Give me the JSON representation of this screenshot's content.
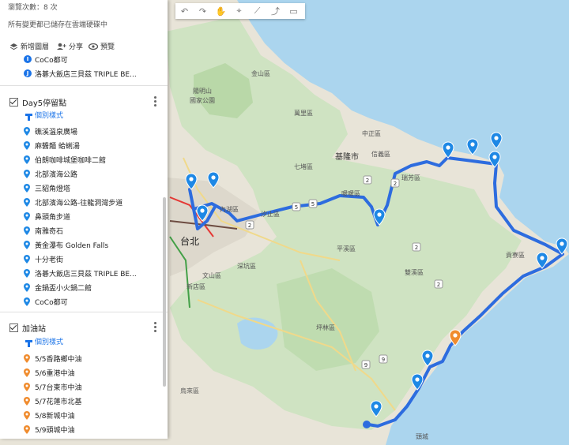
{
  "panel": {
    "views_line": "瀏覽次數：8 次",
    "saved_line": "所有變更都已儲存在雲端硬碟中",
    "actions": {
      "add_layer": "新增圖層",
      "share": "分享",
      "preview": "預覽"
    },
    "top_list": [
      {
        "badge": "I",
        "label": "CoCo都可"
      },
      {
        "badge": "J",
        "label": "洛碁大飯店三貝茲 TRIPLE BE..."
      }
    ],
    "layers": [
      {
        "title": "Day5停留點",
        "style_link": "個別樣式",
        "items": [
          {
            "label": "礁溪溫泉廣場",
            "color": "#1e88e5"
          },
          {
            "label": "麻醬麵 蛤蜊湯",
            "color": "#1e88e5"
          },
          {
            "label": "伯朗咖啡城堡咖啡二館",
            "color": "#1e88e5"
          },
          {
            "label": "北部濱海公路",
            "color": "#1e88e5"
          },
          {
            "label": "三貂角燈塔",
            "color": "#1e88e5"
          },
          {
            "label": "北部濱海公路-往龍洞灣步道",
            "color": "#1e88e5"
          },
          {
            "label": "鼻頭角步道",
            "color": "#1e88e5"
          },
          {
            "label": "南雅奇石",
            "color": "#1e88e5"
          },
          {
            "label": "黃金瀑布 Golden Falls",
            "color": "#1e88e5"
          },
          {
            "label": "十分老街",
            "color": "#1e88e5"
          },
          {
            "label": "洛碁大飯店三貝茲 TRIPLE BE...",
            "color": "#1e88e5"
          },
          {
            "label": "金鍋盃小火鍋二館",
            "color": "#1e88e5"
          },
          {
            "label": "CoCo都可",
            "color": "#1e88e5"
          }
        ]
      },
      {
        "title": "加油站",
        "style_link": "個別樣式",
        "items": [
          {
            "label": "5/5香路鄉中油",
            "color": "#f08c2e"
          },
          {
            "label": "5/6重港中油",
            "color": "#f08c2e"
          },
          {
            "label": "5/7台東市中油",
            "color": "#f08c2e"
          },
          {
            "label": "5/7花蓮市北基",
            "color": "#f08c2e"
          },
          {
            "label": "5/8新城中油",
            "color": "#f08c2e"
          },
          {
            "label": "5/9頭城中油",
            "color": "#f08c2e"
          }
        ]
      }
    ]
  },
  "toolbar": {
    "tools": [
      "undo-icon",
      "redo-icon",
      "hand-icon",
      "marker-icon",
      "draw-line-icon",
      "directions-icon",
      "ruler-icon"
    ],
    "glyphs": [
      "↶",
      "↷",
      "✋",
      "⌖",
      "⟋",
      "⤴",
      "▭"
    ]
  },
  "map": {
    "route_color": "#2d6cdf",
    "labels": {
      "jinshan": "金山區",
      "yangming_1": "陽明山",
      "yangming_2": "國家公園",
      "wanli": "萬里區",
      "zhongzheng": "中正區",
      "keelung": "基隆市",
      "xinyi": "信義區",
      "qidu": "七堵區",
      "ruifang": "瑞芳區",
      "nuannuan": "暖暖區",
      "neihu": "內湖區",
      "xizhi": "汐止區",
      "taipei": "台北",
      "pingxi": "平溪區",
      "gongliao": "貢寮區",
      "shuangxi": "雙溪區",
      "shenkeng": "深坑區",
      "wenshan": "文山區",
      "xindian": "新店區",
      "pinglin": "坪林區",
      "wulai": "烏來區",
      "toucheng": "頭城"
    },
    "pins": [
      {
        "letter": "",
        "color": "#1e88e5"
      },
      {
        "letter": "",
        "color": "#1e88e5"
      },
      {
        "letter": "",
        "color": "#1e88e5"
      },
      {
        "letter": "",
        "color": "#1e88e5"
      },
      {
        "letter": "",
        "color": "#1e88e5"
      },
      {
        "letter": "",
        "color": "#1e88e5"
      },
      {
        "letter": "",
        "color": "#1e88e5"
      },
      {
        "letter": "",
        "color": "#1e88e5"
      },
      {
        "letter": "",
        "color": "#1e88e5"
      },
      {
        "letter": "",
        "color": "#1e88e5"
      },
      {
        "letter": "",
        "color": "#1e88e5"
      },
      {
        "letter": "",
        "color": "#1e88e5"
      },
      {
        "letter": "",
        "color": "#1e88e5"
      },
      {
        "letter": "",
        "color": "#f08c2e"
      }
    ],
    "road_shields": [
      "5",
      "5",
      "2",
      "2",
      "2",
      "2",
      "9",
      "9",
      "2"
    ]
  }
}
